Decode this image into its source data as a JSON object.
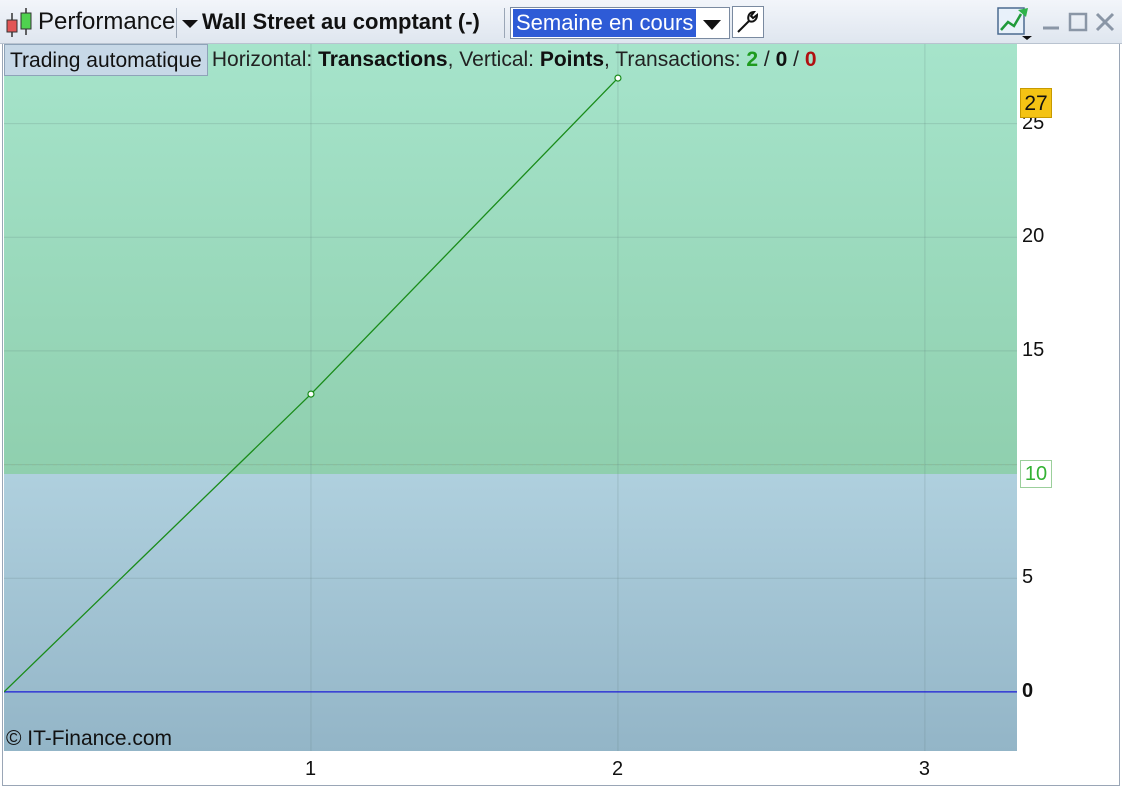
{
  "titlebar": {
    "module_label": "Performance",
    "instrument": "Wall Street au comptant (-)",
    "period": "Semaine en cours",
    "icons": [
      "candlestick-icon",
      "wrench-icon",
      "chart-export-icon",
      "minimize-icon",
      "maximize-icon",
      "close-icon"
    ]
  },
  "info": {
    "button_label": "Trading automatique",
    "horizontal_label": "Horizontal: ",
    "horizontal_value": "Transactions",
    "vertical_label": ", Vertical: ",
    "vertical_value": "Points",
    "transactions_label": ", Transactions: ",
    "tx_win": "2",
    "slash1": " / ",
    "tx_neutral": "0",
    "slash2": " / ",
    "tx_loss": "0"
  },
  "chart_data": {
    "type": "line",
    "x": [
      0,
      1,
      2
    ],
    "series": [
      {
        "values": [
          0,
          13.1,
          27
        ]
      }
    ],
    "xlim": [
      0,
      3.3
    ],
    "ylim": [
      -2.6,
      28.5
    ],
    "x_ticks": [
      "1",
      "2",
      "3"
    ],
    "y_ticks": [
      "0",
      "5",
      "10",
      "15",
      "20",
      "25"
    ],
    "last_value_tag": "27",
    "threshold_tag": "10",
    "threshold": 10,
    "colors": {
      "line": "#1a8c1a",
      "zero_line": "#1c1cd6",
      "upper_zone": "#a0dcc2",
      "lower_zone": "#a8c9d8",
      "last_tag": "#f4c314"
    }
  },
  "footer": {
    "copyright": "© IT-Finance.com"
  }
}
